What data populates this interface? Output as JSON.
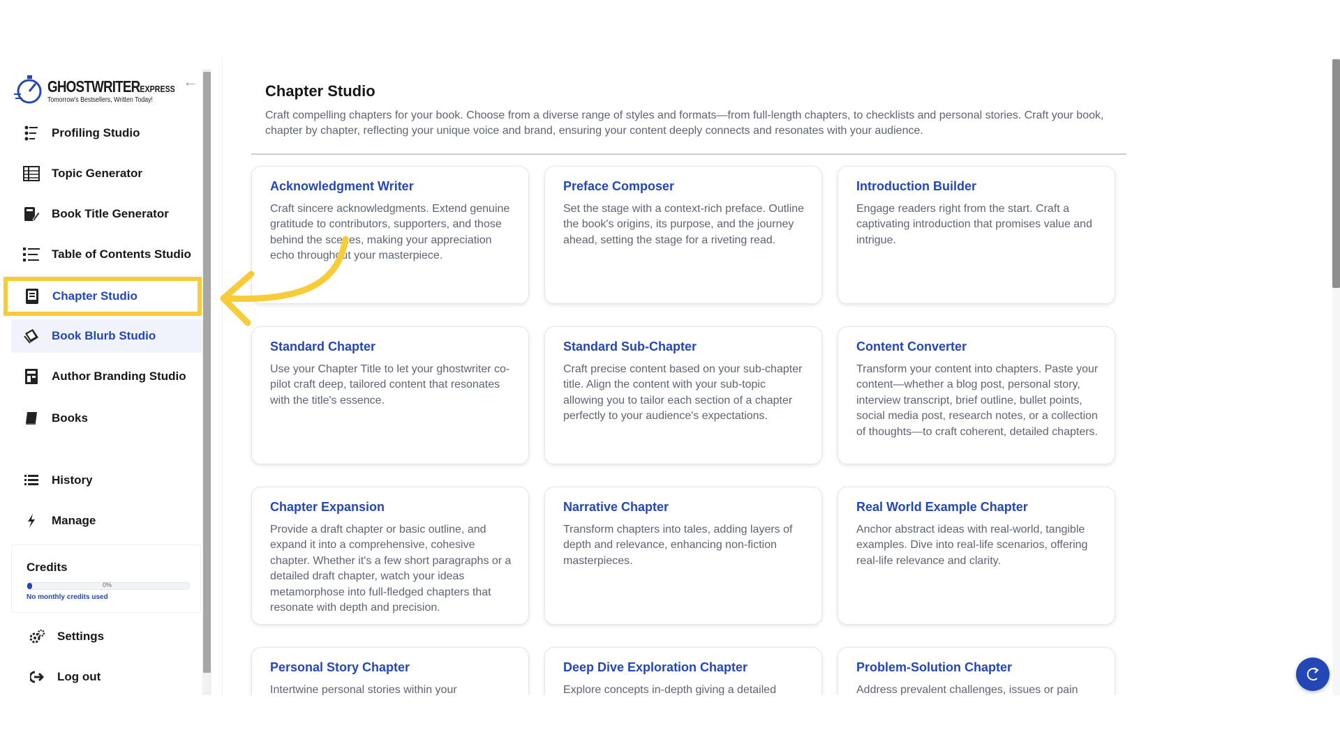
{
  "brand": {
    "name": "GHOSTWRITER",
    "suffix": "EXPRESS",
    "tagline": "Tomorrow's Bestsellers, Written Today!"
  },
  "sidebar": {
    "items": [
      {
        "label": "Profiling Studio",
        "icon": "profile-list-icon"
      },
      {
        "label": "Topic Generator",
        "icon": "topic-grid-icon"
      },
      {
        "label": "Book Title Generator",
        "icon": "book-pencil-icon"
      },
      {
        "label": "Table of Contents Studio",
        "icon": "toc-list-icon"
      },
      {
        "label": "Chapter Studio",
        "icon": "chapter-book-icon"
      },
      {
        "label": "Book Blurb Studio",
        "icon": "blurb-book-icon"
      },
      {
        "label": "Author Branding Studio",
        "icon": "branding-icon"
      },
      {
        "label": "Books",
        "icon": "books-icon"
      },
      {
        "label": "History",
        "icon": "history-list-icon"
      },
      {
        "label": "Manage",
        "icon": "bolt-icon"
      },
      {
        "label": "Settings",
        "icon": "gears-icon"
      },
      {
        "label": "Log out",
        "icon": "logout-icon"
      }
    ],
    "credits": {
      "title": "Credits",
      "percent": 0,
      "percent_label": "0%",
      "note": "No monthly credits used"
    }
  },
  "main": {
    "title": "Chapter Studio",
    "description": "Craft compelling chapters for your book. Choose from a diverse range of styles and formats—from full-length chapters, to checklists and personal stories. Craft your book, chapter by chapter, reflecting your unique voice and brand, ensuring your content deeply connects and resonates with your audience.",
    "cards": [
      {
        "title": "Acknowledgment Writer",
        "desc": "Craft sincere acknowledgments. Extend genuine gratitude to contributors, supporters, and those behind the scenes, making your appreciation echo throughout your masterpiece."
      },
      {
        "title": "Preface Composer",
        "desc": "Set the stage with a context-rich preface. Outline the book's origins, its purpose, and the journey ahead, setting the stage for a riveting read."
      },
      {
        "title": "Introduction Builder",
        "desc": "Engage readers right from the start. Craft a captivating introduction that promises value and intrigue."
      },
      {
        "title": "Standard Chapter",
        "desc": "Use your Chapter Title to let your ghostwriter co-pilot craft deep, tailored content that resonates with the title's essence."
      },
      {
        "title": "Standard Sub-Chapter",
        "desc": "Craft precise content based on your sub-chapter title. Align the content with your sub-topic allowing you to tailor each section of a chapter perfectly to your audience's expectations."
      },
      {
        "title": "Content Converter",
        "desc": "Transform your content into chapters. Paste your content—whether a blog post, personal story, interview transcript, brief outline, bullet points, social media post, research notes, or a collection of thoughts—to craft coherent, detailed chapters."
      },
      {
        "title": "Chapter Expansion",
        "desc": "Provide a draft chapter or basic outline, and expand it into a comprehensive, cohesive chapter. Whether it's a few short paragraphs or a detailed draft chapter, watch your ideas metamorphose into full-fledged chapters that resonate with depth and precision."
      },
      {
        "title": "Narrative Chapter",
        "desc": "Transform chapters into tales, adding layers of depth and relevance, enhancing non-fiction masterpieces."
      },
      {
        "title": "Real World Example Chapter",
        "desc": "Anchor abstract ideas with real-world, tangible examples. Dive into real-life scenarios, offering real-life relevance and clarity."
      },
      {
        "title": "Personal Story Chapter",
        "desc": "Intertwine personal stories within your"
      },
      {
        "title": "Deep Dive Exploration Chapter",
        "desc": "Explore concepts in-depth giving a detailed"
      },
      {
        "title": "Problem-Solution Chapter",
        "desc": "Address prevalent challenges, issues or pain"
      }
    ]
  },
  "colors": {
    "accent": "#2447b8",
    "highlight": "#f8cc38",
    "text": "#15171a",
    "muted": "#5d6470"
  }
}
